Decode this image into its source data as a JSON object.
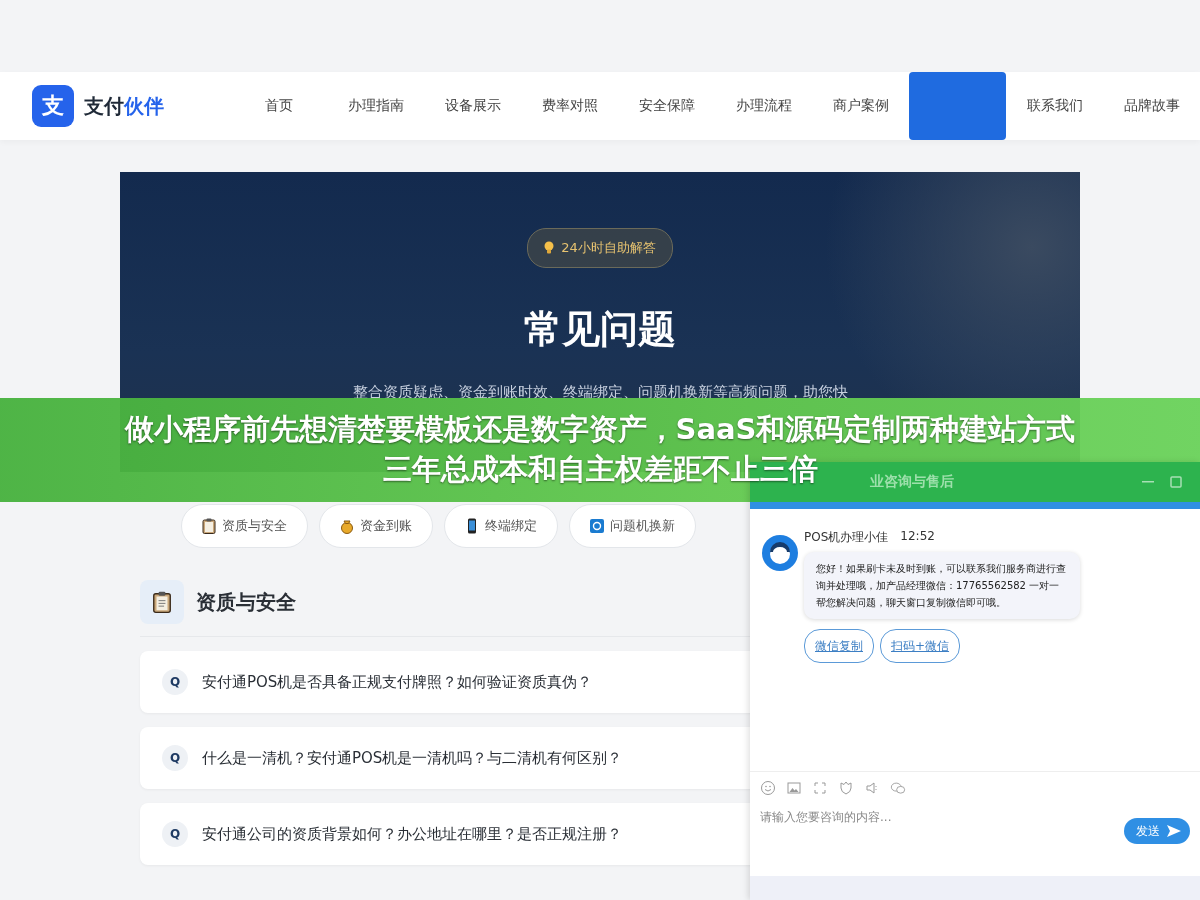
{
  "header": {
    "logo_mark": "支",
    "brand_main": "支付",
    "brand_accent": "伙伴"
  },
  "nav": [
    {
      "label": "首页",
      "selected": false
    },
    {
      "label": "办理指南",
      "selected": false
    },
    {
      "label": "设备展示",
      "selected": false
    },
    {
      "label": "费率对照",
      "selected": false
    },
    {
      "label": "安全保障",
      "selected": false
    },
    {
      "label": "办理流程",
      "selected": false
    },
    {
      "label": "商户案例",
      "selected": false
    },
    {
      "selected": true
    },
    {
      "label": "联系我们",
      "selected": false
    },
    {
      "label": "品牌故事",
      "selected": false
    }
  ],
  "hero": {
    "badge": "24小时自助解答",
    "title": "常见问题",
    "subtitle": "整合资质疑虑、资金到账时效、终端绑定、问题机换新等高频问题，助您快"
  },
  "categories": [
    {
      "kind": "clipboard",
      "label": "资质与安全"
    },
    {
      "kind": "moneybag",
      "label": "资金到账"
    },
    {
      "kind": "phone",
      "label": "终端绑定"
    },
    {
      "kind": "refresh",
      "label": "问题机换新"
    }
  ],
  "section": {
    "title": "资质与安全"
  },
  "faqs": [
    {
      "marker": "Q",
      "question": "安付通POS机是否具备正规支付牌照？如何验证资质真伪？"
    },
    {
      "marker": "Q",
      "question": "什么是一清机？安付通POS机是一清机吗？与二清机有何区别？"
    },
    {
      "marker": "Q",
      "question": "安付通公司的资质背景如何？办公地址在哪里？是否正规注册？"
    }
  ],
  "banner": {
    "lines": [
      "做小程序前先想清楚要模板还是数字资产，SaaS和源码定制两种建站方式",
      "三年总成本和自主权差距不止三倍"
    ]
  },
  "chat": {
    "title": "业咨询与售后",
    "agent": "POS机办理小佳",
    "time": "12:52",
    "message": "您好！如果刷卡未及时到账，可以联系我们服务商进行查询并处理哦，加产品经理微信：17765562582 一对一帮您解决问题，聊天窗口复制微信即可哦。",
    "quick_replies": [
      "微信复制",
      "扫码+微信"
    ],
    "placeholder": "请输入您要咨询的内容...",
    "send": "发送"
  }
}
